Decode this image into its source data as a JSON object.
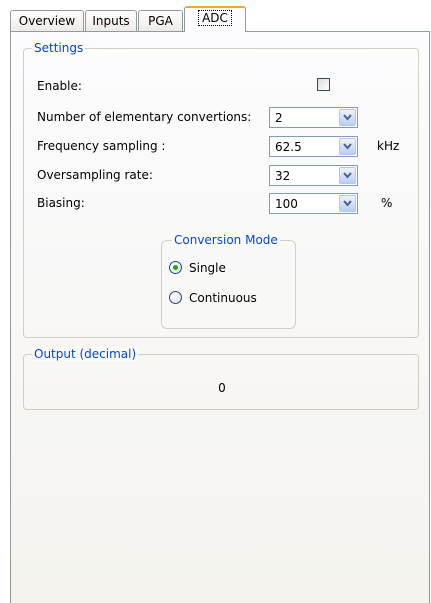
{
  "tabs": [
    {
      "label": "Overview"
    },
    {
      "label": "Inputs"
    },
    {
      "label": "PGA"
    },
    {
      "label": "ADC",
      "active": true
    }
  ],
  "settings": {
    "title": "Settings",
    "enable": {
      "label": "Enable:",
      "checked": false
    },
    "elementary_conversions": {
      "label": "Number of elementary convertions:",
      "value": "2"
    },
    "frequency_sampling": {
      "label": "Frequency sampling :",
      "value": "62.5",
      "unit": "kHz"
    },
    "oversampling_rate": {
      "label": "Oversampling rate:",
      "value": "32"
    },
    "biasing": {
      "label": "Biasing:",
      "value": "100",
      "unit": "%"
    },
    "conversion_mode": {
      "title": "Conversion Mode",
      "options": [
        {
          "label": "Single",
          "selected": true
        },
        {
          "label": "Continuous",
          "selected": false
        }
      ]
    }
  },
  "output": {
    "title": "Output (decimal)",
    "value": "0"
  },
  "colors": {
    "group_title": "#0046d5",
    "active_tab_accent": "#f5a623",
    "radio_dot": "#21a121"
  }
}
